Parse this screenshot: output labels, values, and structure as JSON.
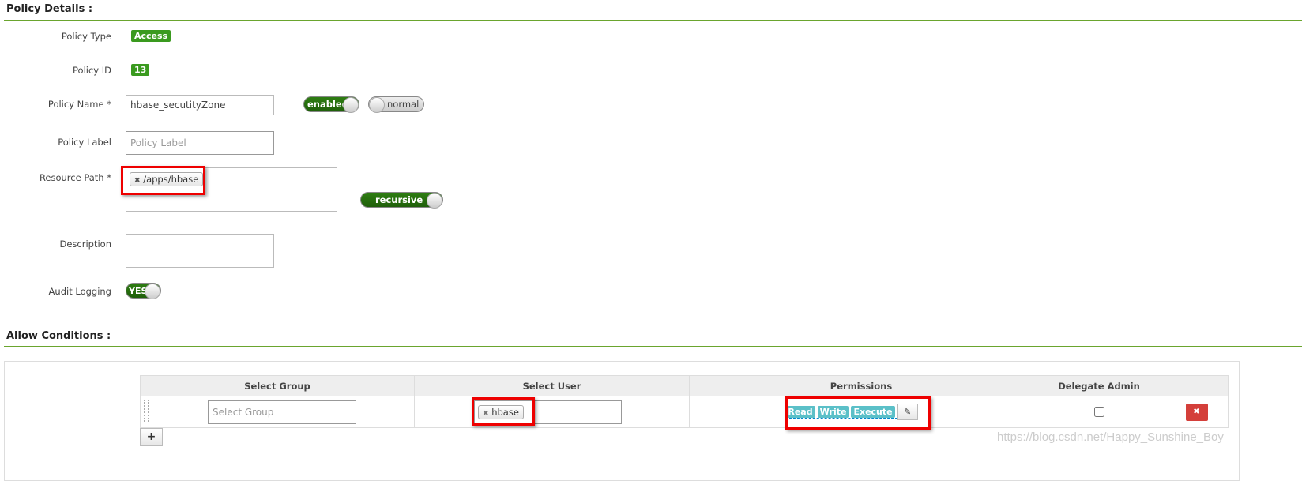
{
  "policy_details": {
    "title": "Policy Details :",
    "policy_type": {
      "label": "Policy Type",
      "value": "Access"
    },
    "policy_id": {
      "label": "Policy ID",
      "value": "13"
    },
    "policy_name": {
      "label": "Policy Name *",
      "value": "hbase_secutityZone",
      "enabled_toggle": "enabled",
      "normal_toggle": "normal"
    },
    "policy_label": {
      "label": "Policy Label",
      "placeholder": "Policy Label"
    },
    "resource_path": {
      "label": "Resource Path *",
      "tags": [
        "/apps/hbase"
      ],
      "recursive_toggle": "recursive"
    },
    "description": {
      "label": "Description",
      "value": ""
    },
    "audit_logging": {
      "label": "Audit Logging",
      "value": "YES"
    }
  },
  "allow_conditions": {
    "title": "Allow Conditions :",
    "columns": [
      "Select Group",
      "Select User",
      "Permissions",
      "Delegate Admin",
      ""
    ],
    "rows": [
      {
        "group_placeholder": "Select Group",
        "users": [
          "hbase"
        ],
        "permissions": [
          "Read",
          "Write",
          "Execute"
        ],
        "delegate_admin": false
      }
    ],
    "add_label": "+"
  },
  "watermark": "https://blog.csdn.net/Happy_Sunshine_Boy",
  "colors": {
    "accent_green": "#3a9a1f",
    "permission_tag": "#5bc0c8",
    "delete": "#d43f3a",
    "highlight": "#e00000"
  }
}
